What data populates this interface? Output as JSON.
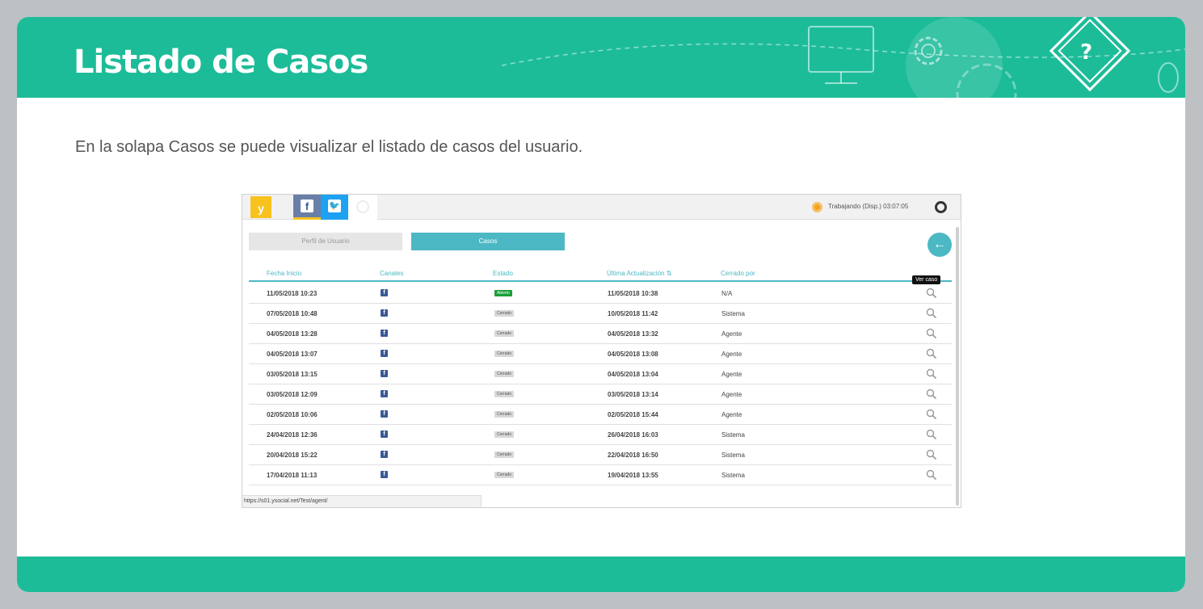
{
  "slide": {
    "title": "Listado de Casos",
    "intro": "En la solapa Casos se puede visualizar el listado de casos del usuario."
  },
  "app": {
    "logo": "y",
    "status": "Trabajando (Disp.)  03:07:05",
    "tabs": [
      {
        "label": "Perfil de Usuario"
      },
      {
        "label": "Casos"
      }
    ],
    "columns": [
      "Fecha Inicio",
      "Canales",
      "Estado",
      "Última Actualización ⇅",
      "Cerrado por"
    ],
    "tooltip": "Ver caso",
    "url": "https://s01.ysocial.net/Test/agent/",
    "rows": [
      {
        "fecha": "11/05/2018 10:23",
        "estado": "Abierto",
        "actualizacion": "11/05/2018 10:38",
        "cerrado": "N/A"
      },
      {
        "fecha": "07/05/2018 10:48",
        "estado": "Cerrado",
        "actualizacion": "10/05/2018 11:42",
        "cerrado": "Sistema"
      },
      {
        "fecha": "04/05/2018 13:28",
        "estado": "Cerrado",
        "actualizacion": "04/05/2018 13:32",
        "cerrado": "Agente"
      },
      {
        "fecha": "04/05/2018 13:07",
        "estado": "Cerrado",
        "actualizacion": "04/05/2018 13:08",
        "cerrado": "Agente"
      },
      {
        "fecha": "03/05/2018 13:15",
        "estado": "Cerrado",
        "actualizacion": "04/05/2018 13:04",
        "cerrado": "Agente"
      },
      {
        "fecha": "03/05/2018 12:09",
        "estado": "Cerrado",
        "actualizacion": "03/05/2018 13:14",
        "cerrado": "Agente"
      },
      {
        "fecha": "02/05/2018 10:06",
        "estado": "Cerrado",
        "actualizacion": "02/05/2018 15:44",
        "cerrado": "Agente"
      },
      {
        "fecha": "24/04/2018 12:36",
        "estado": "Cerrado",
        "actualizacion": "26/04/2018 16:03",
        "cerrado": "Sistema"
      },
      {
        "fecha": "20/04/2018 15:22",
        "estado": "Cerrado",
        "actualizacion": "22/04/2018 16:50",
        "cerrado": "Sistema"
      },
      {
        "fecha": "17/04/2018 11:13",
        "estado": "Cerrado",
        "actualizacion": "19/04/2018 13:55",
        "cerrado": "Sistema"
      }
    ]
  },
  "colors": {
    "brand": "#1dbc99",
    "accent": "#4cb8c4",
    "open": "#1b9e3a"
  }
}
